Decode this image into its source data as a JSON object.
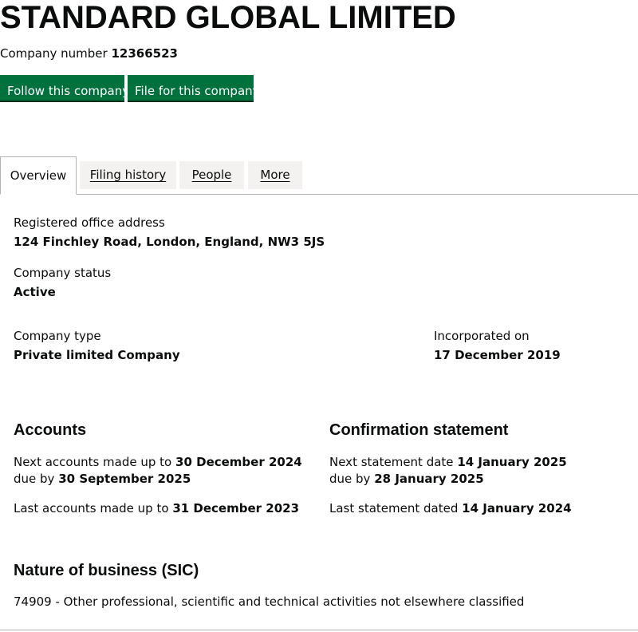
{
  "company": {
    "name": "STANDARD GLOBAL LIMITED",
    "number_label": "Company number",
    "number": "12366523"
  },
  "actions": {
    "follow_label": "Follow this company",
    "file_label": "File for this company"
  },
  "tabs": [
    {
      "label": "Overview",
      "active": true
    },
    {
      "label": "Filing history",
      "active": false
    },
    {
      "label": "People",
      "active": false
    },
    {
      "label": "More",
      "active": false
    }
  ],
  "overview": {
    "registered_office_label": "Registered office address",
    "registered_office_value": "124 Finchley Road, London, England, NW3 5JS",
    "status_label": "Company status",
    "status_value": "Active",
    "type_label": "Company type",
    "type_value": "Private limited Company",
    "incorporated_label": "Incorporated on",
    "incorporated_value": "17 December 2019"
  },
  "accounts": {
    "heading": "Accounts",
    "next_prefix": "Next accounts made up to",
    "next_date": "30 December 2024",
    "due_prefix": "due by",
    "due_date": "30 September 2025",
    "last_prefix": "Last accounts made up to",
    "last_date": "31 December 2023"
  },
  "confirmation": {
    "heading": "Confirmation statement",
    "next_prefix": "Next statement date",
    "next_date": "14 January 2025",
    "due_prefix": "due by",
    "due_date": "28 January 2025",
    "last_prefix": "Last statement dated",
    "last_date": "14 January 2024"
  },
  "nature": {
    "heading": "Nature of business (SIC)",
    "item": "74909 - Other professional, scientific and technical activities not elsewhere classified"
  }
}
